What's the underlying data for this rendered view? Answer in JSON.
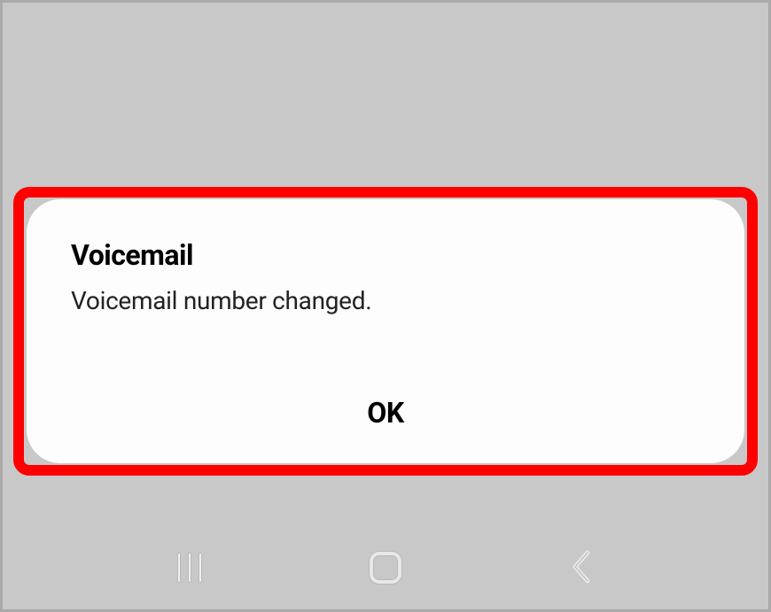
{
  "dialog": {
    "title": "Voicemail",
    "message": "Voicemail number changed.",
    "ok_label": "OK"
  },
  "nav": {
    "recent": "recent-apps",
    "home": "home",
    "back": "back"
  }
}
